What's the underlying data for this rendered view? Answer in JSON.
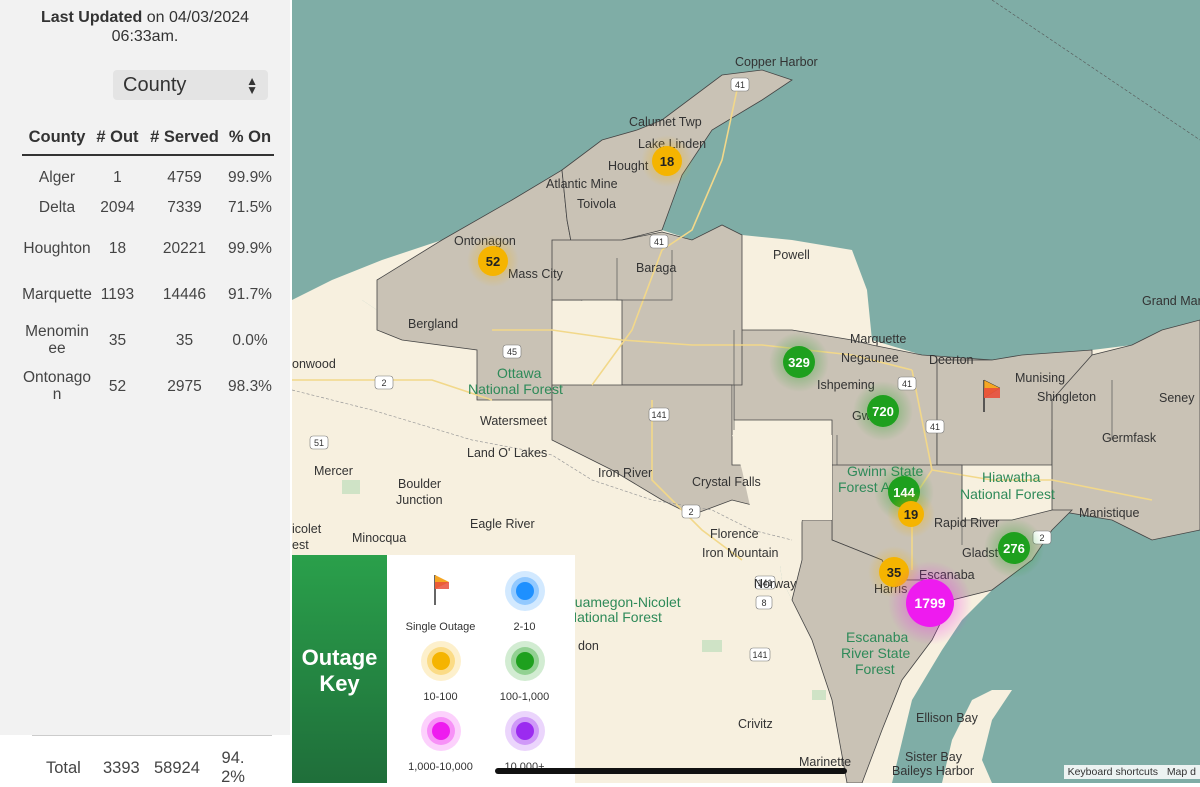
{
  "sidebar": {
    "updated_prefix": "Last Updated",
    "updated_text": " on 04/03/2024 06:33am.",
    "select_value": "County",
    "headers": [
      "County",
      "# Out",
      "# Served",
      "% On"
    ],
    "rows": [
      {
        "county": "Alger",
        "out": "1",
        "served": "4759",
        "pct": "99.9%"
      },
      {
        "county": "Delta",
        "out": "2094",
        "served": "7339",
        "pct": "71.5%"
      },
      {
        "county": "Houghton",
        "out": "18",
        "served": "20221",
        "pct": "99.9%"
      },
      {
        "county": "Marquette",
        "out": "1193",
        "served": "14446",
        "pct": "91.7%"
      },
      {
        "county": "Menominee",
        "out": "35",
        "served": "35",
        "pct": "0.0%"
      },
      {
        "county": "Ontonagon",
        "out": "52",
        "served": "2975",
        "pct": "98.3%"
      }
    ],
    "total": {
      "label": "Total",
      "out": "3393",
      "served": "58924",
      "pct": "94.2%"
    }
  },
  "map": {
    "place_labels": {
      "copper_harbor": "Copper Harbor",
      "calumet": "Calumet Twp",
      "lake_linden": "Lake Linden",
      "houghton": "Hought",
      "atlantic_mine": "Atlantic Mine",
      "toivola": "Toivola",
      "ontonagon": "Ontonagon",
      "mass_city": "Mass City",
      "baraga": "Baraga",
      "powell": "Powell",
      "grand_marais": "Grand Marai",
      "bergland": "Bergland",
      "marquette": "Marquette",
      "negaunee": "Negaunee",
      "deerton": "Deerton",
      "munising": "Munising",
      "shingleton": "Shingleton",
      "seney": "Seney",
      "ironwood": "onwood",
      "ishpeming": "Ishpeming",
      "gwinn": "Gw",
      "watersmeet": "Watersmeet",
      "germfask": "Germfask",
      "land_o_lakes": "Land O' Lakes",
      "iron_river": "Iron River",
      "crystal_falls": "Crystal Falls",
      "mercer": "Mercer",
      "boulder": "Boulder",
      "junction": "Junction",
      "forest_a": "Forest A",
      "manistique": "Manistique",
      "rapid_river": "Rapid River",
      "eagle_river": "Eagle River",
      "florence": "Florence",
      "minocqua": "Minocqua",
      "iron_mountain": "Iron Mountain",
      "gladstone": "Gladst",
      "escanaba": "Escanaba",
      "norway": "Norway",
      "harris": "Harris",
      "nicolet": "icolet",
      "est": "est",
      "don": "don",
      "crivitz": "Crivitz",
      "ellison_bay": "Ellison Bay",
      "marinette": "Marinette",
      "sister_bay": "Sister Bay",
      "baileys_harbor": "Baileys Harbor"
    },
    "park_labels": {
      "ottawa_1": "Ottawa",
      "ottawa_2": "National Forest",
      "gwinn_1": "Gwinn State",
      "gwinn_2": "Forest A",
      "hiawatha_1": "Hiawatha",
      "hiawatha_2": "National Forest",
      "chequamegon_1": "quamegon-Nicolet",
      "chequamegon_2": "National Forest",
      "escanaba_1": "Escanaba",
      "escanaba_2": "River State",
      "escanaba_3": "Forest"
    },
    "route_shields": [
      "41",
      "41",
      "45",
      "2",
      "141",
      "51",
      "2",
      "41",
      "41",
      "2",
      "141",
      "8",
      "141",
      "2"
    ],
    "clusters": [
      {
        "count": "18",
        "color": "#f5b400"
      },
      {
        "count": "52",
        "color": "#f5b400"
      },
      {
        "count": "329",
        "color": "#1ea01e"
      },
      {
        "count": "720",
        "color": "#1ea01e"
      },
      {
        "count": "144",
        "color": "#1ea01e"
      },
      {
        "count": "19",
        "color": "#f5b400"
      },
      {
        "count": "276",
        "color": "#1ea01e"
      },
      {
        "count": "35",
        "color": "#f5b400"
      },
      {
        "count": "1799",
        "color": "#ee1bef"
      }
    ],
    "colors": {
      "water": "#7fada6",
      "county_fill": "#c9c2b5",
      "land": "#f7f0df"
    },
    "attribution": "Keyboard shortcuts",
    "attribution_2": "Map d"
  },
  "key": {
    "title_1": "Outage",
    "title_2": "Key",
    "items": [
      {
        "label": "Single Outage",
        "icon": "flag-icon"
      },
      {
        "label": "2-10",
        "color": "#1e90ff"
      },
      {
        "label": "10-100",
        "color": "#f5b400"
      },
      {
        "label": "100-1,000",
        "color": "#1ea01e"
      },
      {
        "label": "1,000-10,000",
        "color": "#ee1bef"
      },
      {
        "label": "10,000+",
        "color": "#9b2bf0"
      }
    ]
  }
}
